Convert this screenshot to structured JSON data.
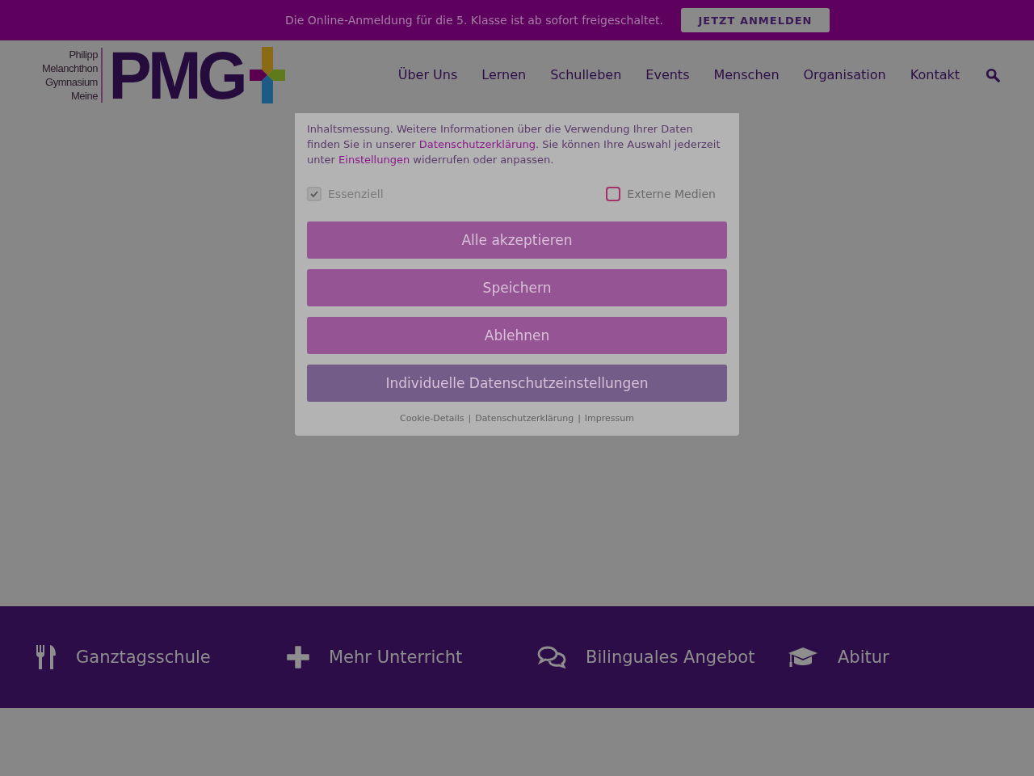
{
  "announcement": {
    "text": "Die Online-Anmeldung für die 5. Klasse ist ab sofort freigeschaltet.",
    "button": "JETZT ANMELDEN"
  },
  "logo": {
    "lines": [
      "Philipp",
      "Melanchthon",
      "Gymnasium",
      "Meine"
    ],
    "letters": "PMG"
  },
  "nav": {
    "items": [
      "Über Uns",
      "Lernen",
      "Schulleben",
      "Events",
      "Menschen",
      "Organisation",
      "Kontakt"
    ]
  },
  "features": [
    {
      "kind": "fork-knife",
      "label": "Ganztagsschule"
    },
    {
      "kind": "plus",
      "label": "Mehr Unterricht"
    },
    {
      "kind": "chat",
      "label": "Bilinguales Angebot"
    },
    {
      "kind": "graduation",
      "label": "Abitur"
    }
  ],
  "cookie_dialog": {
    "text_parts": [
      {
        "kind": "text",
        "text": "Inhaltsmessung. Weitere Informationen über die Verwendung Ihrer Daten finden Sie in unserer "
      },
      {
        "kind": "link",
        "text": "Datenschutzerklärung"
      },
      {
        "kind": "text",
        "text": ". Sie können Ihre Auswahl jederzeit unter "
      },
      {
        "kind": "link",
        "text": "Einstellungen"
      },
      {
        "kind": "text",
        "text": " widerrufen oder anpassen."
      }
    ],
    "options": [
      {
        "label": "Essenziell",
        "checked": true,
        "disabled": true
      },
      {
        "label": "Externe Medien",
        "checked": false,
        "disabled": false
      }
    ],
    "buttons": [
      {
        "label": "Alle akzeptieren",
        "kind": "primary"
      },
      {
        "label": "Speichern",
        "kind": "primary"
      },
      {
        "label": "Ablehnen",
        "kind": "primary"
      },
      {
        "label": "Individuelle Datenschutzeinstellungen",
        "kind": "secondary"
      }
    ],
    "footer_links": [
      "Cookie-Details",
      "Datenschutzerklärung",
      "Impressum"
    ],
    "footer_separator": "|"
  }
}
